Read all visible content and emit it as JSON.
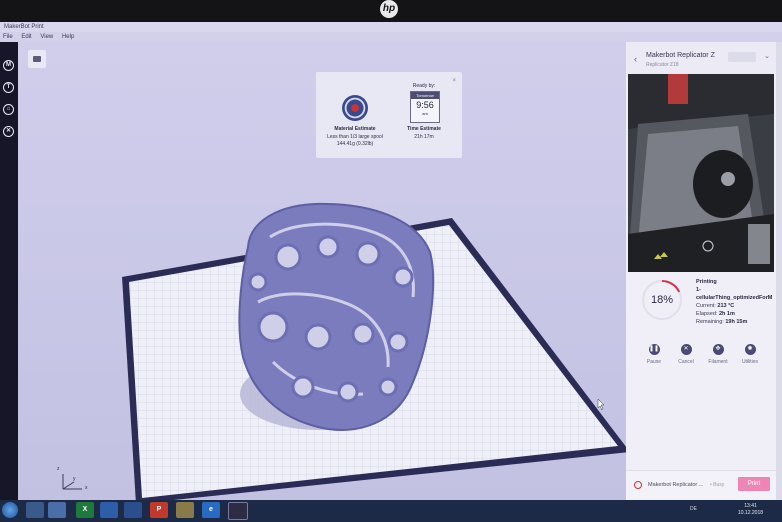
{
  "window": {
    "title": "MakerBot Print"
  },
  "menu": [
    "File",
    "Edit",
    "View",
    "Help"
  ],
  "left_toolbar": [
    "makerbot-icon",
    "thingiverse-icon",
    "store-icon",
    "settings-icon"
  ],
  "estimate": {
    "material_title": "Material Estimate",
    "material_line1": "Less than 1/3 large spool",
    "material_line2": "144.41g (0.32lb)",
    "ready_label": "Ready by:",
    "ready_day": "Tomorrow",
    "ready_time": "9:56",
    "ready_ampm": "am",
    "time_title": "Time Estimate",
    "time_value": "21h 17m",
    "close": "×"
  },
  "axes": {
    "z": "z",
    "y": "y",
    "x": "x"
  },
  "panel": {
    "printer_name": "Makerbot Replicator Z",
    "printer_sub": "Replicator Z18",
    "progress_text": "18%",
    "progress": 0.18,
    "status_title": "Printing",
    "file_line1": "1-",
    "file_line2": "cellularThing_optimizedForM",
    "current_label": "Current:",
    "current_value": "213 °C",
    "elapsed_label": "Elapsed:",
    "elapsed_value": "2h 1m",
    "remaining_label": "Remaining:",
    "remaining_value": "19h 15m",
    "controls": [
      "Pause",
      "Cancel",
      "Filament",
      "Utilities"
    ],
    "footer_printer": "Makerbot Replicator ...",
    "footer_status": "• Busy",
    "print_label": "Print"
  },
  "taskbar": {
    "apps": [
      "",
      "",
      "X",
      "",
      "P",
      "",
      "e",
      ""
    ],
    "lang": "DE",
    "time": "13:41",
    "date": "10.12.2018"
  },
  "colors": {
    "accent_pink": "#ee86b5",
    "print_object": "#6e6fb2",
    "bed_border": "#2b2c55"
  }
}
